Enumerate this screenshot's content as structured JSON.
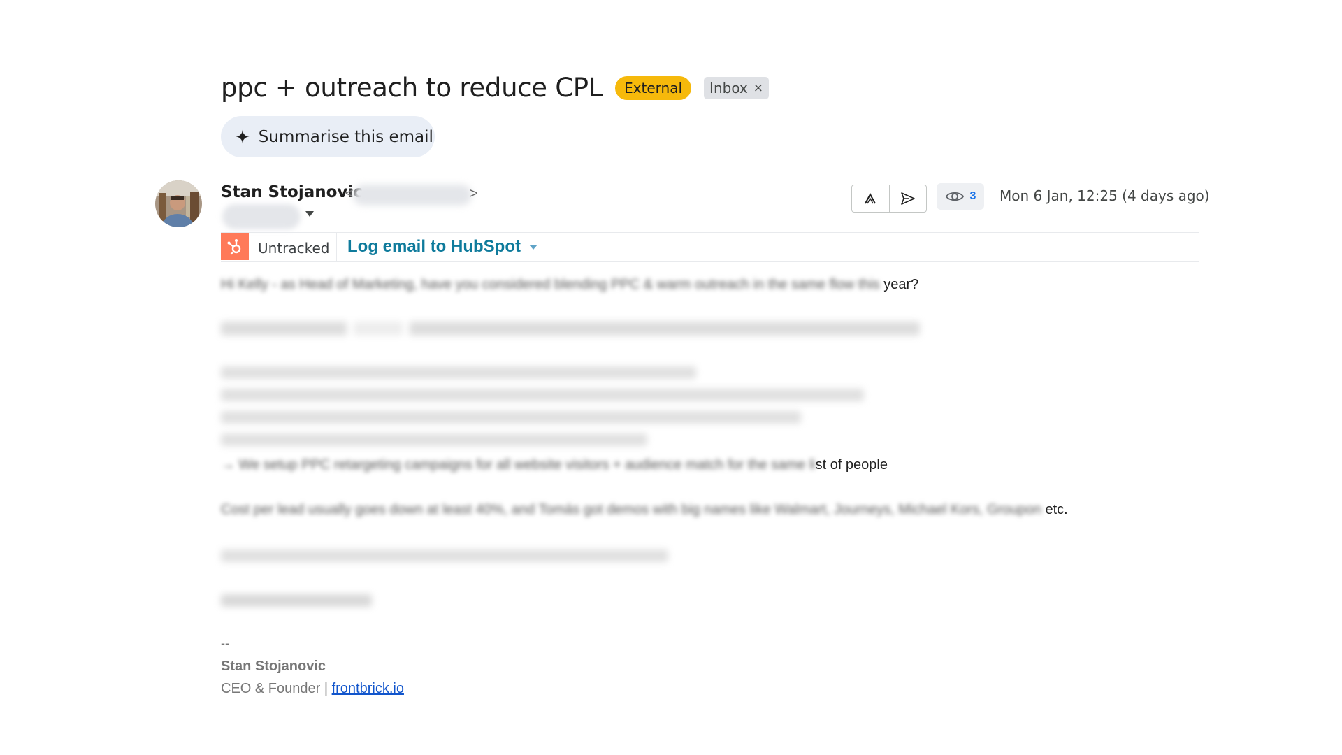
{
  "subject": "ppc + outreach to reduce CPL",
  "labels": {
    "external": "External",
    "inbox": "Inbox",
    "inbox_remove": "×"
  },
  "summarise": {
    "icon": "sparkle-icon",
    "label": "Summarise this email"
  },
  "sender": {
    "name": "Stan Stojanovic",
    "email_open": "<",
    "email_close": ">"
  },
  "toolbar": {
    "reply_icon": "caret-up-icon",
    "send_icon": "send-icon"
  },
  "views": {
    "icon": "eye-icon",
    "count": "3"
  },
  "date": "Mon 6 Jan, 12:25 (4 days ago)",
  "hubspot": {
    "status": "Untracked",
    "log_label": "Log email to HubSpot",
    "brand_color": "#ff7a59",
    "link_color": "#0f7b9c"
  },
  "body": {
    "line1_blur": "Hi Kelly - as Head of Marketing, have you considered blending PPC & warm outreach in the same flow this",
    "line1_clear": " year?",
    "bullet5_blur": "→ We setup PPC retargeting campaigns for all website visitors + audience match for the same li",
    "bullet5_clear": "st of people",
    "cost_blur": "Cost per lead usually goes down at least 40%, and Tomás got demos with big names like Walmart, Journeys, Michael Kors, Groupon",
    "cost_clear": " etc."
  },
  "signature": {
    "separator": "--",
    "name": "Stan Stojanovic",
    "title_prefix": "CEO & Founder | ",
    "link": "frontbrick.io"
  }
}
